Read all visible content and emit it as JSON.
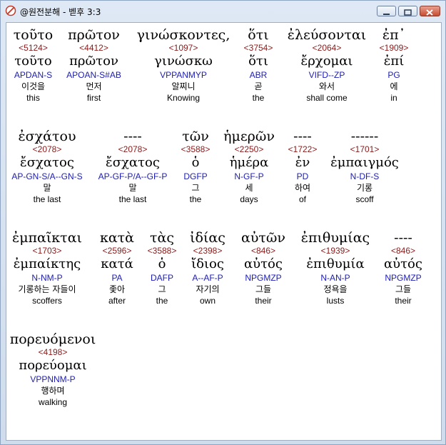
{
  "window": {
    "title": "@원전분해 - 벧후 3:3",
    "icon": "app-icon",
    "controls": [
      "minimize-icon",
      "maximize-icon",
      "close-icon"
    ]
  },
  "words": [
    {
      "greek": "τοῦτο",
      "num": "<5124>",
      "lemma": "τοῦτο",
      "parse": "APDAN-S",
      "kor": "이것을",
      "eng": "this"
    },
    {
      "greek": "πρῶτον",
      "num": "<4412>",
      "lemma": "πρῶτον",
      "parse": "APOAN-S#AB",
      "kor": "먼저",
      "eng": "first"
    },
    {
      "greek": "γινώσκοντες,",
      "num": "<1097>",
      "lemma": "γινώσκω",
      "parse": "VPPANMYP",
      "kor": "알찌니",
      "eng": "Knowing"
    },
    {
      "greek": "ὅτι",
      "num": "<3754>",
      "lemma": "ὅτι",
      "parse": "ABR",
      "kor": "곧",
      "eng": "the"
    },
    {
      "greek": "ἐλεύσονται",
      "num": "<2064>",
      "lemma": "ἔρχομαι",
      "parse": "VIFD--ZP",
      "kor": "와서",
      "eng": "shall come"
    },
    {
      "greek": "ἐπ᾽",
      "num": "<1909>",
      "lemma": "ἐπί",
      "parse": "PG",
      "kor": "에",
      "eng": "in"
    },
    {
      "greek": "ἐσχάτου",
      "num": "<2078>",
      "lemma": "ἔσχατος",
      "parse": "AP-GN-S/A--GN-S",
      "kor": "말",
      "eng": "the last"
    },
    {
      "greek": "----",
      "num": "<2078>",
      "lemma": "ἔσχατος",
      "parse": "AP-GF-P/A--GF-P",
      "kor": "말",
      "eng": "the last"
    },
    {
      "greek": "τῶν",
      "num": "<3588>",
      "lemma": "ὁ",
      "parse": "DGFP",
      "kor": "그",
      "eng": "the"
    },
    {
      "greek": "ἡμερῶν",
      "num": "<2250>",
      "lemma": "ἡμέρα",
      "parse": "N-GF-P",
      "kor": "세",
      "eng": "days"
    },
    {
      "greek": "----",
      "num": "<1722>",
      "lemma": "ἐν",
      "parse": "PD",
      "kor": "하여",
      "eng": "of"
    },
    {
      "greek": "------",
      "num": "<1701>",
      "lemma": "ἐμπαιγμός",
      "parse": "N-DF-S",
      "kor": "기롱",
      "eng": "scoff"
    },
    {
      "greek": "ἐμπαῖκται",
      "num": "<1703>",
      "lemma": "ἐμπαίκτης",
      "parse": "N-NM-P",
      "kor": "기롱하는 자들이",
      "eng": "scoffers"
    },
    {
      "greek": "κατὰ",
      "num": "<2596>",
      "lemma": "κατά",
      "parse": "PA",
      "kor": "좇아",
      "eng": "after"
    },
    {
      "greek": "τὰς",
      "num": "<3588>",
      "lemma": "ὁ",
      "parse": "DAFP",
      "kor": "그",
      "eng": "the"
    },
    {
      "greek": "ἰδίας",
      "num": "<2398>",
      "lemma": "ἴδιος",
      "parse": "A--AF-P",
      "kor": "자기의",
      "eng": "own"
    },
    {
      "greek": "αὐτῶν",
      "num": "<846>",
      "lemma": "αὐτός",
      "parse": "NPGMZP",
      "kor": "그들",
      "eng": "their"
    },
    {
      "greek": "ἐπιθυμίας",
      "num": "<1939>",
      "lemma": "ἐπιθυμία",
      "parse": "N-AN-P",
      "kor": "정욕을",
      "eng": "lusts"
    },
    {
      "greek": "----",
      "num": "<846>",
      "lemma": "αὐτός",
      "parse": "NPGMZP",
      "kor": "그들",
      "eng": "their"
    },
    {
      "greek": "πορευόμενοι",
      "num": "<4198>",
      "lemma": "πορεύομαι",
      "parse": "VPPNNM-P",
      "kor": "행하며",
      "eng": "walking"
    }
  ],
  "colors": {
    "strong": "#8b1a1a",
    "parse": "#1c1cb5",
    "highlight": "#ffffff"
  }
}
